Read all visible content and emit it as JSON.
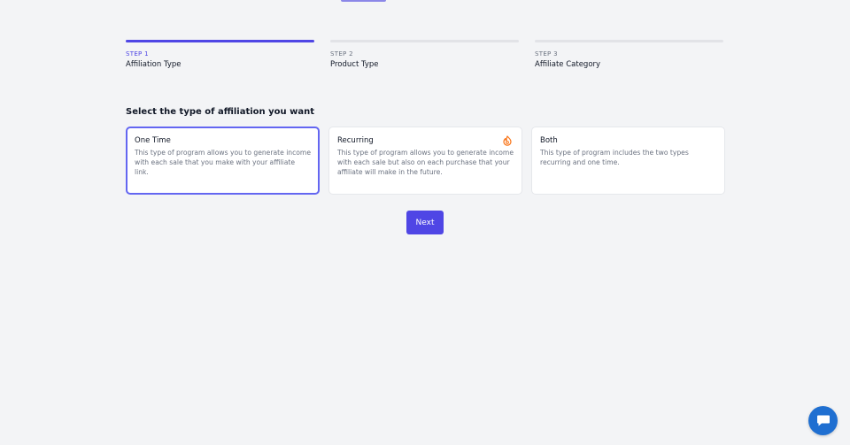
{
  "steps": [
    {
      "number": "STEP 1",
      "title": "Affiliation Type",
      "active": true
    },
    {
      "number": "STEP 2",
      "title": "Product Type",
      "active": false
    },
    {
      "number": "STEP 3",
      "title": "Affiliate Category",
      "active": false
    }
  ],
  "question": "Select the type of affiliation you want",
  "options": [
    {
      "title": "One Time",
      "description": "This type of program allows you to generate income with each sale that you make with your affiliate link.",
      "selected": true
    },
    {
      "title": "Recurring",
      "description": "This type of program allows you to generate income with each sale but also on each purchase that your affiliate will make in the future.",
      "selected": false,
      "icon": "fire-icon"
    },
    {
      "title": "Both",
      "description": "This type of program includes the two types recurring and one time.",
      "selected": false
    }
  ],
  "next_label": "Next",
  "chat_icon": "chat-bubble-icon",
  "colors": {
    "accent": "#4f46e5",
    "icon_orange": "#f97316",
    "chat_blue": "#1f6fd1"
  }
}
